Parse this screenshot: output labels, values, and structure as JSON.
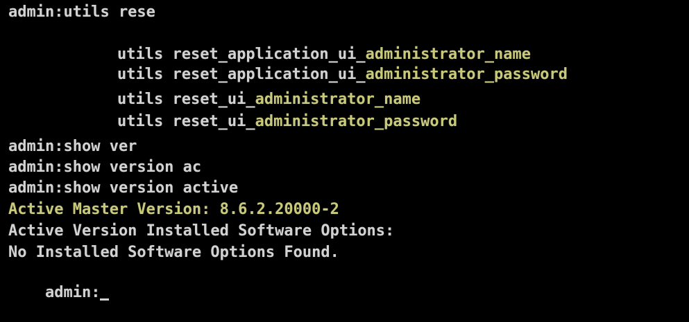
{
  "terminal": {
    "colors": {
      "background": "#000000",
      "text": "#d2d2d2",
      "highlight": "#c9c97a"
    },
    "lines": {
      "l1": "admin:utils rese",
      "l2_prefix": "utils reset_application_ui_",
      "l2_hl": "administrator_name",
      "l3_prefix": "utils reset_application_ui_",
      "l3_hl": "administrator_password",
      "l4_prefix": "utils reset_ui_",
      "l4_hl": "administrator_name",
      "l5_prefix": "utils reset_ui_",
      "l5_hl": "administrator_password",
      "l7": "admin:show ver",
      "l8": "admin:show version ac",
      "l9": "admin:show version active",
      "l10": "Active Master Version: 8.6.2.20000-2",
      "l11": "Active Version Installed Software Options:",
      "l12": "No Installed Software Options Found.",
      "l13_prompt": "admin:"
    }
  }
}
